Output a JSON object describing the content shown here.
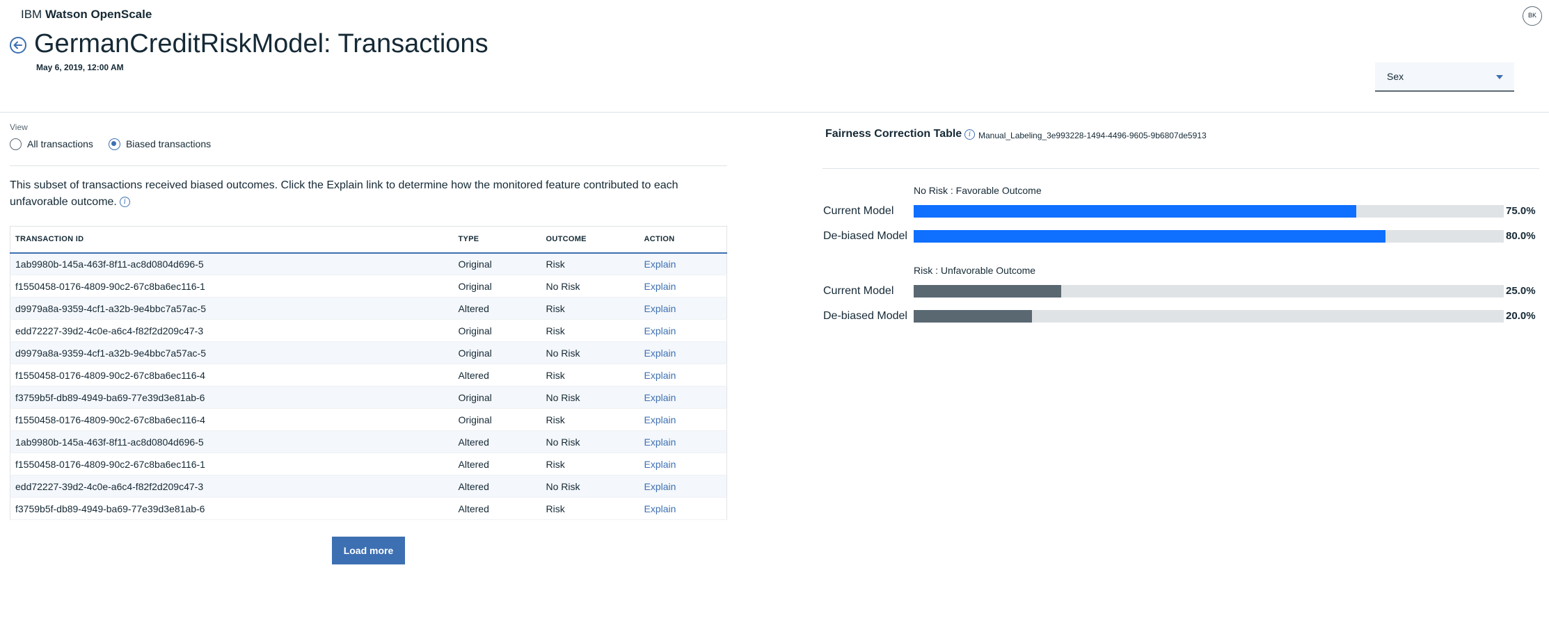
{
  "brand": {
    "company": "IBM",
    "product": "Watson OpenScale"
  },
  "user": {
    "initials": "BK"
  },
  "header": {
    "title": "GermanCreditRiskModel: Transactions",
    "date": "May 6, 2019, 12:00 AM",
    "back_icon": "arrow-left-circle-icon"
  },
  "attribute_select": {
    "value": "Sex"
  },
  "view": {
    "label": "View",
    "options": [
      {
        "label": "All transactions",
        "selected": false
      },
      {
        "label": "Biased transactions",
        "selected": true
      }
    ]
  },
  "intro": {
    "text": "This subset of transactions received biased outcomes. Click the Explain link to determine how the monitored feature contributed to each unfavorable outcome."
  },
  "table": {
    "headers": [
      "TRANSACTION ID",
      "TYPE",
      "OUTCOME",
      "ACTION"
    ],
    "rows": [
      {
        "id": "1ab9980b-145a-463f-8f11-ac8d0804d696-5",
        "type": "Original",
        "outcome": "Risk",
        "action": "Explain"
      },
      {
        "id": "f1550458-0176-4809-90c2-67c8ba6ec116-1",
        "type": "Original",
        "outcome": "No Risk",
        "action": "Explain"
      },
      {
        "id": "d9979a8a-9359-4cf1-a32b-9e4bbc7a57ac-5",
        "type": "Altered",
        "outcome": "Risk",
        "action": "Explain"
      },
      {
        "id": "edd72227-39d2-4c0e-a6c4-f82f2d209c47-3",
        "type": "Original",
        "outcome": "Risk",
        "action": "Explain"
      },
      {
        "id": "d9979a8a-9359-4cf1-a32b-9e4bbc7a57ac-5",
        "type": "Original",
        "outcome": "No Risk",
        "action": "Explain"
      },
      {
        "id": "f1550458-0176-4809-90c2-67c8ba6ec116-4",
        "type": "Altered",
        "outcome": "Risk",
        "action": "Explain"
      },
      {
        "id": "f3759b5f-db89-4949-ba69-77e39d3e81ab-6",
        "type": "Original",
        "outcome": "No Risk",
        "action": "Explain"
      },
      {
        "id": "f1550458-0176-4809-90c2-67c8ba6ec116-4",
        "type": "Original",
        "outcome": "Risk",
        "action": "Explain"
      },
      {
        "id": "1ab9980b-145a-463f-8f11-ac8d0804d696-5",
        "type": "Altered",
        "outcome": "No Risk",
        "action": "Explain"
      },
      {
        "id": "f1550458-0176-4809-90c2-67c8ba6ec116-1",
        "type": "Altered",
        "outcome": "Risk",
        "action": "Explain"
      },
      {
        "id": "edd72227-39d2-4c0e-a6c4-f82f2d209c47-3",
        "type": "Altered",
        "outcome": "No Risk",
        "action": "Explain"
      },
      {
        "id": "f3759b5f-db89-4949-ba69-77e39d3e81ab-6",
        "type": "Altered",
        "outcome": "Risk",
        "action": "Explain"
      }
    ]
  },
  "load_more": {
    "label": "Load more"
  },
  "fairness": {
    "title": "Fairness Correction Table",
    "id": "Manual_Labeling_3e993228-1494-4496-9605-9b6807de5913",
    "groups": [
      {
        "label": "No Risk : Favorable Outcome",
        "color": "#0f6fff",
        "bars": [
          {
            "label": "Current Model",
            "value": 75.0,
            "value_text": "75.0%"
          },
          {
            "label": "De-biased Model",
            "value": 80.0,
            "value_text": "80.0%"
          }
        ]
      },
      {
        "label": "Risk : Unfavorable Outcome",
        "color": "#5a6872",
        "bars": [
          {
            "label": "Current Model",
            "value": 25.0,
            "value_text": "25.0%"
          },
          {
            "label": "De-biased Model",
            "value": 20.0,
            "value_text": "20.0%"
          }
        ]
      }
    ]
  }
}
